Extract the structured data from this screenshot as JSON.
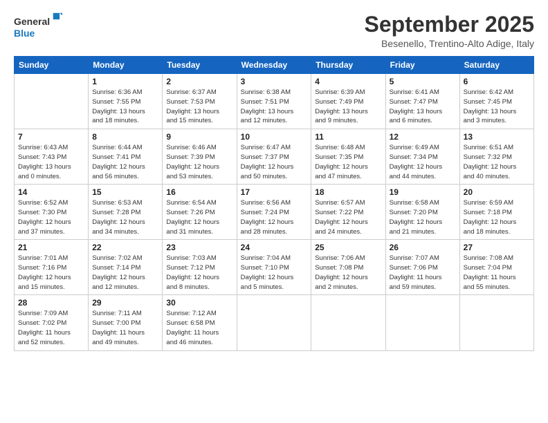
{
  "header": {
    "logo": {
      "line1": "General",
      "line2": "Blue"
    },
    "title": "September 2025",
    "location": "Besenello, Trentino-Alto Adige, Italy"
  },
  "days_of_week": [
    "Sunday",
    "Monday",
    "Tuesday",
    "Wednesday",
    "Thursday",
    "Friday",
    "Saturday"
  ],
  "weeks": [
    [
      {
        "day": "",
        "info": ""
      },
      {
        "day": "1",
        "info": "Sunrise: 6:36 AM\nSunset: 7:55 PM\nDaylight: 13 hours\nand 18 minutes."
      },
      {
        "day": "2",
        "info": "Sunrise: 6:37 AM\nSunset: 7:53 PM\nDaylight: 13 hours\nand 15 minutes."
      },
      {
        "day": "3",
        "info": "Sunrise: 6:38 AM\nSunset: 7:51 PM\nDaylight: 13 hours\nand 12 minutes."
      },
      {
        "day": "4",
        "info": "Sunrise: 6:39 AM\nSunset: 7:49 PM\nDaylight: 13 hours\nand 9 minutes."
      },
      {
        "day": "5",
        "info": "Sunrise: 6:41 AM\nSunset: 7:47 PM\nDaylight: 13 hours\nand 6 minutes."
      },
      {
        "day": "6",
        "info": "Sunrise: 6:42 AM\nSunset: 7:45 PM\nDaylight: 13 hours\nand 3 minutes."
      }
    ],
    [
      {
        "day": "7",
        "info": "Sunrise: 6:43 AM\nSunset: 7:43 PM\nDaylight: 13 hours\nand 0 minutes."
      },
      {
        "day": "8",
        "info": "Sunrise: 6:44 AM\nSunset: 7:41 PM\nDaylight: 12 hours\nand 56 minutes."
      },
      {
        "day": "9",
        "info": "Sunrise: 6:46 AM\nSunset: 7:39 PM\nDaylight: 12 hours\nand 53 minutes."
      },
      {
        "day": "10",
        "info": "Sunrise: 6:47 AM\nSunset: 7:37 PM\nDaylight: 12 hours\nand 50 minutes."
      },
      {
        "day": "11",
        "info": "Sunrise: 6:48 AM\nSunset: 7:35 PM\nDaylight: 12 hours\nand 47 minutes."
      },
      {
        "day": "12",
        "info": "Sunrise: 6:49 AM\nSunset: 7:34 PM\nDaylight: 12 hours\nand 44 minutes."
      },
      {
        "day": "13",
        "info": "Sunrise: 6:51 AM\nSunset: 7:32 PM\nDaylight: 12 hours\nand 40 minutes."
      }
    ],
    [
      {
        "day": "14",
        "info": "Sunrise: 6:52 AM\nSunset: 7:30 PM\nDaylight: 12 hours\nand 37 minutes."
      },
      {
        "day": "15",
        "info": "Sunrise: 6:53 AM\nSunset: 7:28 PM\nDaylight: 12 hours\nand 34 minutes."
      },
      {
        "day": "16",
        "info": "Sunrise: 6:54 AM\nSunset: 7:26 PM\nDaylight: 12 hours\nand 31 minutes."
      },
      {
        "day": "17",
        "info": "Sunrise: 6:56 AM\nSunset: 7:24 PM\nDaylight: 12 hours\nand 28 minutes."
      },
      {
        "day": "18",
        "info": "Sunrise: 6:57 AM\nSunset: 7:22 PM\nDaylight: 12 hours\nand 24 minutes."
      },
      {
        "day": "19",
        "info": "Sunrise: 6:58 AM\nSunset: 7:20 PM\nDaylight: 12 hours\nand 21 minutes."
      },
      {
        "day": "20",
        "info": "Sunrise: 6:59 AM\nSunset: 7:18 PM\nDaylight: 12 hours\nand 18 minutes."
      }
    ],
    [
      {
        "day": "21",
        "info": "Sunrise: 7:01 AM\nSunset: 7:16 PM\nDaylight: 12 hours\nand 15 minutes."
      },
      {
        "day": "22",
        "info": "Sunrise: 7:02 AM\nSunset: 7:14 PM\nDaylight: 12 hours\nand 12 minutes."
      },
      {
        "day": "23",
        "info": "Sunrise: 7:03 AM\nSunset: 7:12 PM\nDaylight: 12 hours\nand 8 minutes."
      },
      {
        "day": "24",
        "info": "Sunrise: 7:04 AM\nSunset: 7:10 PM\nDaylight: 12 hours\nand 5 minutes."
      },
      {
        "day": "25",
        "info": "Sunrise: 7:06 AM\nSunset: 7:08 PM\nDaylight: 12 hours\nand 2 minutes."
      },
      {
        "day": "26",
        "info": "Sunrise: 7:07 AM\nSunset: 7:06 PM\nDaylight: 11 hours\nand 59 minutes."
      },
      {
        "day": "27",
        "info": "Sunrise: 7:08 AM\nSunset: 7:04 PM\nDaylight: 11 hours\nand 55 minutes."
      }
    ],
    [
      {
        "day": "28",
        "info": "Sunrise: 7:09 AM\nSunset: 7:02 PM\nDaylight: 11 hours\nand 52 minutes."
      },
      {
        "day": "29",
        "info": "Sunrise: 7:11 AM\nSunset: 7:00 PM\nDaylight: 11 hours\nand 49 minutes."
      },
      {
        "day": "30",
        "info": "Sunrise: 7:12 AM\nSunset: 6:58 PM\nDaylight: 11 hours\nand 46 minutes."
      },
      {
        "day": "",
        "info": ""
      },
      {
        "day": "",
        "info": ""
      },
      {
        "day": "",
        "info": ""
      },
      {
        "day": "",
        "info": ""
      }
    ]
  ]
}
